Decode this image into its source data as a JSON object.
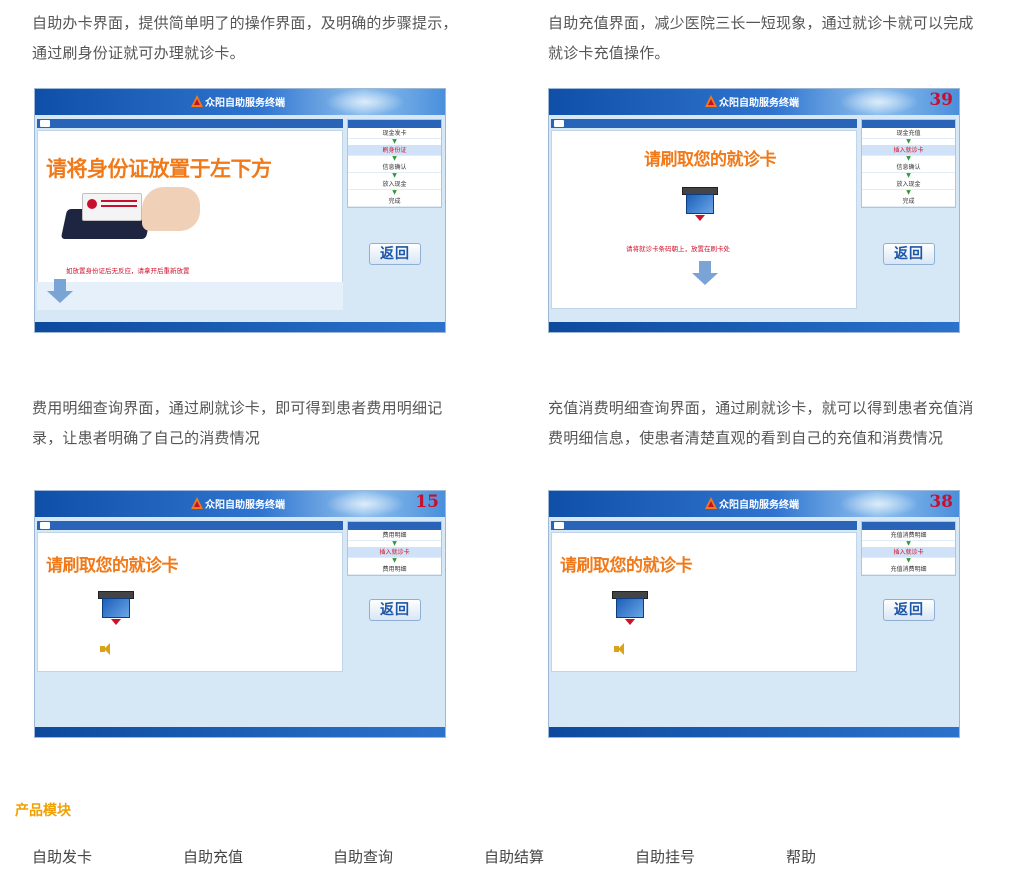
{
  "descriptions": [
    "自助办卡界面，提供简单明了的操作界面，及明确的步骤提示，通过刷身份证就可办理就诊卡。",
    "自助充值界面，减少医院三长一短现象，通过就诊卡就可以完成就诊卡充值操作。",
    "费用明细查询界面，通过刷就诊卡，即可得到患者费用明细记录，让患者明确了自己的消费情况",
    "充值消费明细查询界面，通过刷就诊卡，就可以得到患者充值消费明细信息，使患者清楚直观的看到自己的充值和消费情况"
  ],
  "terminal": {
    "title": "众阳自助服务终端",
    "back_label": "返回"
  },
  "screens": [
    {
      "counter": "",
      "prompt": "请将身份证放置于左下方",
      "steps": [
        "现金发卡",
        "刷身份证",
        "信息确认",
        "放入现金",
        "完成"
      ],
      "active_step": 1,
      "hint": "如放置身份证后无反应，请拿开后重新放置"
    },
    {
      "counter": "39",
      "prompt": "请刷取您的就诊卡",
      "steps": [
        "现金充值",
        "插入就诊卡",
        "信息确认",
        "放入现金",
        "完成"
      ],
      "active_step": 1,
      "hint": "请将就诊卡条码朝上，放置在刷卡处"
    },
    {
      "counter": "15",
      "prompt": "请刷取您的就诊卡",
      "steps": [
        "费用明细",
        "插入就诊卡",
        "费用明细"
      ],
      "active_step": 1,
      "hint": ""
    },
    {
      "counter": "38",
      "prompt": "请刷取您的就诊卡",
      "steps": [
        "充值消费明细",
        "插入就诊卡",
        "充值消费明细"
      ],
      "active_step": 1,
      "hint": ""
    }
  ],
  "section_title": "产品模块",
  "modules": [
    "自助发卡",
    "自助充值",
    "自助查询",
    "自助结算",
    "自助挂号",
    "帮助"
  ],
  "colors": {
    "accent": "#f0a000",
    "prompt_orange": "#f07a1a",
    "header_blue": "#2f74cf",
    "alert_red": "#d0102a"
  }
}
